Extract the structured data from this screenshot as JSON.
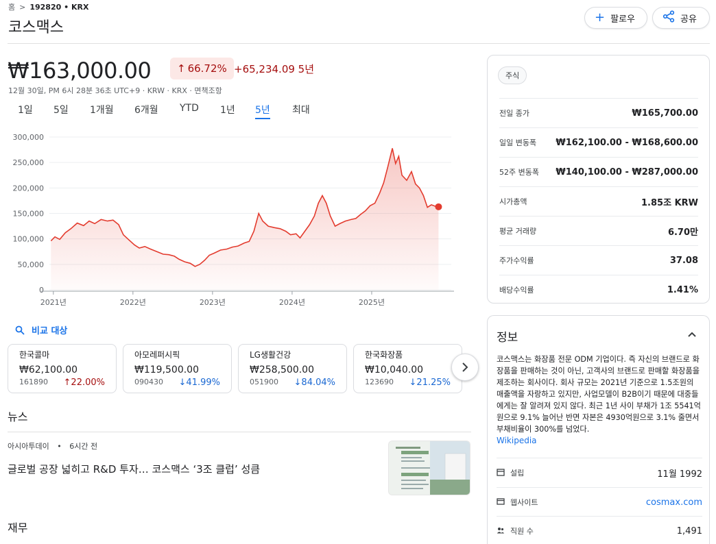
{
  "breadcrumb": {
    "home": "홈",
    "separator": ">",
    "current": "192820 • KRX"
  },
  "header": {
    "title": "코스맥스",
    "follow_label": "팔로우",
    "share_label": "공유"
  },
  "quote": {
    "price": "₩163,000.00",
    "change_pct": "66.72%",
    "change_abs": "+65,234.09 5년",
    "meta": "12월 30일, PM 6시 28분 36초 UTC+9 · KRW · KRX · 면책조항"
  },
  "range_tabs": [
    "1일",
    "5일",
    "1개월",
    "6개월",
    "YTD",
    "1년",
    "5년",
    "최대"
  ],
  "range_active": "5년",
  "chart_data": {
    "type": "area",
    "x_ticks": [
      "2021년",
      "2022년",
      "2023년",
      "2024년",
      "2025년"
    ],
    "y_ticks": [
      "300,000",
      "250,000",
      "200,000",
      "150,000",
      "100,000",
      "50,000",
      "0"
    ],
    "ylim": [
      0,
      300000
    ],
    "x_range": [
      2020.95,
      2026.0
    ],
    "line_color": "#e33b2e",
    "points": [
      [
        2020.97,
        96000
      ],
      [
        2021.02,
        104000
      ],
      [
        2021.08,
        99000
      ],
      [
        2021.15,
        112000
      ],
      [
        2021.22,
        120000
      ],
      [
        2021.3,
        131000
      ],
      [
        2021.38,
        126000
      ],
      [
        2021.45,
        135000
      ],
      [
        2021.52,
        130000
      ],
      [
        2021.6,
        138000
      ],
      [
        2021.68,
        135000
      ],
      [
        2021.75,
        137000
      ],
      [
        2021.82,
        128000
      ],
      [
        2021.88,
        108000
      ],
      [
        2021.95,
        98000
      ],
      [
        2022.02,
        88000
      ],
      [
        2022.08,
        82000
      ],
      [
        2022.15,
        85000
      ],
      [
        2022.22,
        80000
      ],
      [
        2022.3,
        75000
      ],
      [
        2022.38,
        70000
      ],
      [
        2022.45,
        69000
      ],
      [
        2022.52,
        66000
      ],
      [
        2022.58,
        60000
      ],
      [
        2022.65,
        55000
      ],
      [
        2022.72,
        52000
      ],
      [
        2022.78,
        46000
      ],
      [
        2022.84,
        50000
      ],
      [
        2022.9,
        58000
      ],
      [
        2022.96,
        68000
      ],
      [
        2023.02,
        72000
      ],
      [
        2023.1,
        78000
      ],
      [
        2023.18,
        80000
      ],
      [
        2023.25,
        84000
      ],
      [
        2023.32,
        86000
      ],
      [
        2023.4,
        92000
      ],
      [
        2023.46,
        95000
      ],
      [
        2023.52,
        115000
      ],
      [
        2023.58,
        150000
      ],
      [
        2023.63,
        135000
      ],
      [
        2023.7,
        125000
      ],
      [
        2023.78,
        122000
      ],
      [
        2023.85,
        120000
      ],
      [
        2023.92,
        115000
      ],
      [
        2023.98,
        108000
      ],
      [
        2024.05,
        110000
      ],
      [
        2024.1,
        102000
      ],
      [
        2024.16,
        115000
      ],
      [
        2024.22,
        128000
      ],
      [
        2024.28,
        145000
      ],
      [
        2024.33,
        170000
      ],
      [
        2024.38,
        185000
      ],
      [
        2024.43,
        170000
      ],
      [
        2024.48,
        145000
      ],
      [
        2024.54,
        125000
      ],
      [
        2024.6,
        130000
      ],
      [
        2024.67,
        135000
      ],
      [
        2024.74,
        138000
      ],
      [
        2024.8,
        140000
      ],
      [
        2024.86,
        148000
      ],
      [
        2024.92,
        155000
      ],
      [
        2024.98,
        165000
      ],
      [
        2025.04,
        170000
      ],
      [
        2025.1,
        190000
      ],
      [
        2025.15,
        210000
      ],
      [
        2025.2,
        240000
      ],
      [
        2025.26,
        278000
      ],
      [
        2025.3,
        248000
      ],
      [
        2025.34,
        262000
      ],
      [
        2025.38,
        225000
      ],
      [
        2025.44,
        215000
      ],
      [
        2025.5,
        232000
      ],
      [
        2025.55,
        208000
      ],
      [
        2025.6,
        200000
      ],
      [
        2025.65,
        185000
      ],
      [
        2025.7,
        162000
      ],
      [
        2025.75,
        167000
      ],
      [
        2025.8,
        164000
      ],
      [
        2025.84,
        163000
      ]
    ]
  },
  "compare": {
    "label": "비교 대상",
    "cards": [
      {
        "name": "한국콜마",
        "price": "₩62,100.00",
        "code": "161890",
        "change": "22.00%",
        "arrow": "↑",
        "dir": "up"
      },
      {
        "name": "아모레퍼시픽",
        "price": "₩119,500.00",
        "code": "090430",
        "change": "41.99%",
        "arrow": "↓",
        "dir": "down"
      },
      {
        "name": "LG생활건강",
        "price": "₩258,500.00",
        "code": "051900",
        "change": "84.04%",
        "arrow": "↓",
        "dir": "down"
      },
      {
        "name": "한국화장품",
        "price": "₩10,040.00",
        "code": "123690",
        "change": "21.25%",
        "arrow": "↓",
        "dir": "down"
      }
    ]
  },
  "news": {
    "section_title": "뉴스",
    "source": "아시아투데이",
    "dot": "•",
    "time": "6시간 전",
    "headline": "글로벌 공장 넓히고 R&D 투자… 코스맥스 ‘3조 클럽’ 성큼"
  },
  "finance": {
    "section_title": "재무"
  },
  "stats": {
    "chip": "주식",
    "rows": [
      {
        "label": "전일 종가",
        "value": "₩165,700.00"
      },
      {
        "label": "일일 변동폭",
        "value": "₩162,100.00 - ₩168,600.00"
      },
      {
        "label": "52주 변동폭",
        "value": "₩140,100.00 - ₩287,000.00"
      },
      {
        "label": "시가총액",
        "value": "1.85조 KRW"
      },
      {
        "label": "평균 거래량",
        "value": "6.70만"
      },
      {
        "label": "주가수익률",
        "value": "37.08"
      },
      {
        "label": "배당수익률",
        "value": "1.41%"
      }
    ]
  },
  "about": {
    "title": "정보",
    "description": "코스맥스는 화장품 전문 ODM 기업이다. 즉 자신의 브랜드로 화장품을 판매하는 것이 아닌, 고객사의 브랜드로 판매할 화장품을 제조하는 회사이다. 회사 규모는 2021년 기준으로 1.5조원의 매출액을 자랑하고 있지만, 사업모델이 B2B이기 때문에 대중들에게는 잘 알려져 있지 않다. 최근 1년 사이 부채가 1조 5541억원으로 9.1% 늘어난 반면 자본은 4930억원으로 3.1% 줄면서 부채비율이 300%를 넘었다.",
    "wiki": "Wikipedia",
    "info": [
      {
        "label": "설립",
        "value": "11월 1992",
        "icon": "calendar-icon"
      },
      {
        "label": "웹사이트",
        "value": "cosmax.com",
        "icon": "website-icon"
      },
      {
        "label": "직원 수",
        "value": "1,491",
        "icon": "people-icon"
      }
    ]
  }
}
